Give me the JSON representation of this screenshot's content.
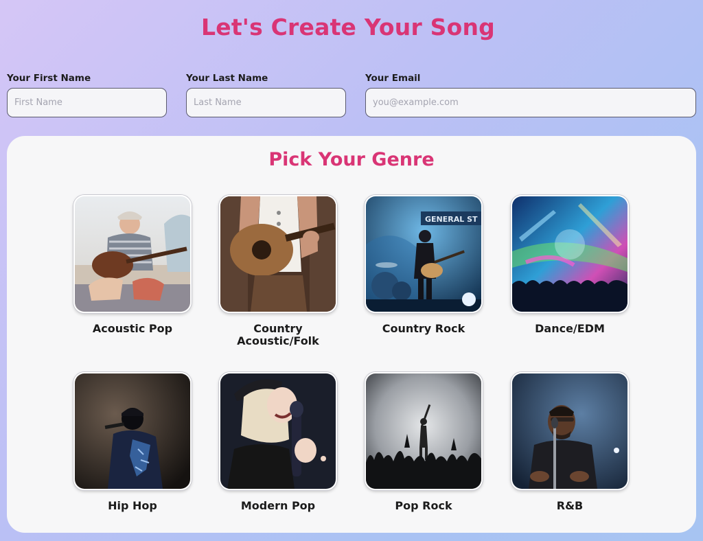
{
  "page": {
    "title": "Let's Create Your Song"
  },
  "form": {
    "first_name": {
      "label": "Your First Name",
      "placeholder": "First Name",
      "value": ""
    },
    "last_name": {
      "label": "Your Last Name",
      "placeholder": "Last Name",
      "value": ""
    },
    "email": {
      "label": "Your Email",
      "placeholder": "you@example.com",
      "value": ""
    }
  },
  "genres": {
    "title": "Pick Your Genre",
    "items": [
      {
        "label": "Acoustic Pop",
        "image": "guitarist-on-beach"
      },
      {
        "label": "Country Acoustic/Folk",
        "image": "acoustic-guitar-closeup"
      },
      {
        "label": "Country Rock",
        "image": "band-on-stage"
      },
      {
        "label": "Dance/EDM",
        "image": "edm-festival-crowd"
      },
      {
        "label": "Hip Hop",
        "image": "rapper-silhouette"
      },
      {
        "label": "Modern Pop",
        "image": "singer-with-microphone"
      },
      {
        "label": "Pop Rock",
        "image": "concert-crowd-silhouette"
      },
      {
        "label": "R&B",
        "image": "singer-with-mic-stand"
      }
    ]
  },
  "colors": {
    "accent": "#d93575",
    "panel": "#f7f7f8",
    "background_start": "#d5c6f6",
    "background_end": "#a7c4f2"
  }
}
